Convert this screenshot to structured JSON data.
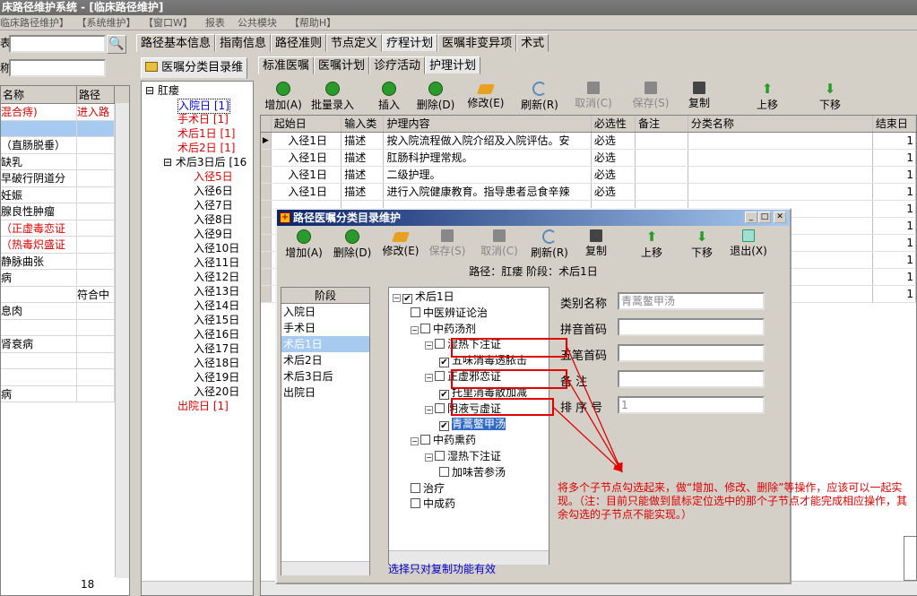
{
  "app": {
    "title": "床路径维护系统 - [临床路径维护]",
    "menu": [
      "临床路径维护】",
      "【系统维护】",
      "【窗口W】",
      "报表",
      "公共模块",
      "【帮助H】"
    ]
  },
  "left": {
    "label_top": "表",
    "label_bottom": "称",
    "headers": [
      "名称",
      "路径"
    ],
    "rows": [
      {
        "name": "混合痔)",
        "path": "进入路",
        "red": true
      },
      {
        "name": "",
        "path": "",
        "selected": true
      },
      {
        "name": "（直肠脱垂）",
        "path": ""
      },
      {
        "name": "缺乳",
        "path": ""
      },
      {
        "name": "早破行阴道分",
        "path": ""
      },
      {
        "name": "妊娠",
        "path": ""
      },
      {
        "name": "腺良性肿瘤",
        "path": ""
      },
      {
        "name": "（正虚毒恋证",
        "path": "",
        "red": true
      },
      {
        "name": "（热毒炽盛证",
        "path": "",
        "red": true
      },
      {
        "name": "静脉曲张",
        "path": ""
      },
      {
        "name": "病",
        "path": ""
      },
      {
        "name": "",
        "path": "符合中"
      },
      {
        "name": "息肉",
        "path": ""
      },
      {
        "name": "",
        "path": ""
      },
      {
        "name": "肾衰病",
        "path": ""
      },
      {
        "name": "",
        "path": ""
      },
      {
        "name": "",
        "path": ""
      },
      {
        "name": "病",
        "path": ""
      }
    ],
    "count": "18"
  },
  "top_tabs": [
    "路径基本信息",
    "指南信息",
    "路径准则",
    "节点定义",
    "疗程计划",
    "医嘱非变异项",
    "术式"
  ],
  "sub_tab": "医嘱分类目录维",
  "inner_tabs": [
    "标准医嘱",
    "医嘱计划",
    "诊疗活动",
    "护理计划"
  ],
  "path_tree": {
    "root": "肛瘘",
    "items": [
      {
        "label": "入院日 [1]",
        "color": "blue",
        "indent": 0
      },
      {
        "label": "手术日 [1]",
        "color": "red",
        "indent": 0
      },
      {
        "label": "术后1日 [1]",
        "color": "red",
        "indent": 0
      },
      {
        "label": "术后2日 [1]",
        "color": "red",
        "indent": 0
      },
      {
        "label": "术后3日后 [16",
        "color": "black",
        "indent": 0
      },
      {
        "label": "入径5日",
        "color": "red",
        "indent": 1
      },
      {
        "label": "入径6日",
        "color": "black",
        "indent": 1
      },
      {
        "label": "入径7日",
        "color": "black",
        "indent": 1
      },
      {
        "label": "入径8日",
        "color": "black",
        "indent": 1
      },
      {
        "label": "入径9日",
        "color": "black",
        "indent": 1
      },
      {
        "label": "入径10日",
        "color": "black",
        "indent": 1
      },
      {
        "label": "入径11日",
        "color": "black",
        "indent": 1
      },
      {
        "label": "入径12日",
        "color": "black",
        "indent": 1
      },
      {
        "label": "入径13日",
        "color": "black",
        "indent": 1
      },
      {
        "label": "入径14日",
        "color": "black",
        "indent": 1
      },
      {
        "label": "入径15日",
        "color": "black",
        "indent": 1
      },
      {
        "label": "入径16日",
        "color": "black",
        "indent": 1
      },
      {
        "label": "入径17日",
        "color": "black",
        "indent": 1
      },
      {
        "label": "入径18日",
        "color": "black",
        "indent": 1
      },
      {
        "label": "入径19日",
        "color": "black",
        "indent": 1
      },
      {
        "label": "入径20日",
        "color": "black",
        "indent": 1
      },
      {
        "label": "出院日 [1]",
        "color": "red",
        "indent": 0
      }
    ]
  },
  "toolbar": [
    {
      "label": "增加(A)",
      "icon": "add-icon",
      "color": "#2a9a2a"
    },
    {
      "label": "批量录入",
      "icon": "batch-add-icon",
      "color": "#2a9a2a"
    },
    {
      "label": "插入",
      "icon": "insert-icon",
      "color": "#2a9a2a"
    },
    {
      "label": "删除(D)",
      "icon": "delete-icon",
      "color": "#2a9a2a"
    },
    {
      "label": "修改(E)",
      "icon": "edit-icon",
      "color": "#e8a020"
    },
    {
      "label": "刷新(R)",
      "icon": "refresh-icon",
      "color": "#5a8ac0"
    },
    {
      "label": "取消(C)",
      "icon": "cancel-icon",
      "color": "#888888"
    },
    {
      "label": "保存(S)",
      "icon": "save-icon",
      "color": "#888888"
    },
    {
      "label": "复制",
      "icon": "copy-icon",
      "color": "#444444"
    },
    {
      "label": "上移",
      "icon": "up-arrow-icon",
      "color": "#2a9a2a"
    },
    {
      "label": "下移",
      "icon": "down-arrow-icon",
      "color": "#2a9a2a"
    }
  ],
  "grid": {
    "headers": [
      "起始日",
      "输入类",
      "护理内容",
      "必选性",
      "备注",
      "分类名称",
      "结束日"
    ],
    "rows": [
      [
        "入径1日",
        "描述",
        "按入院流程做入院介绍及入院评估。安",
        "必选",
        "",
        "",
        "1"
      ],
      [
        "入径1日",
        "描述",
        "肛肠科护理常规。",
        "必选",
        "",
        "",
        "1"
      ],
      [
        "入径1日",
        "描述",
        "二级护理。",
        "必选",
        "",
        "",
        "1"
      ],
      [
        "入径1日",
        "描述",
        "进行入院健康教育。指导患者忌食辛辣",
        "必选",
        "",
        "",
        "1"
      ],
      [
        "",
        "",
        "",
        "",
        "",
        "",
        "1"
      ],
      [
        "",
        "",
        "",
        "",
        "",
        "",
        "1"
      ],
      [
        "",
        "",
        "",
        "",
        "",
        "",
        "1"
      ],
      [
        "",
        "",
        "",
        "",
        "",
        "",
        "1"
      ],
      [
        "",
        "",
        "",
        "",
        "",
        "",
        "1"
      ],
      [
        "",
        "",
        "",
        "",
        "",
        "",
        "1"
      ]
    ]
  },
  "dialog": {
    "title": "路径医嘱分类目录维护",
    "toolbar": [
      {
        "label": "增加(A)",
        "icon": "add-icon",
        "color": "#2a9a2a"
      },
      {
        "label": "删除(D)",
        "icon": "delete-icon",
        "color": "#2a9a2a"
      },
      {
        "label": "修改(E)",
        "icon": "edit-icon",
        "color": "#e8a020"
      },
      {
        "label": "保存(S)",
        "icon": "save-icon",
        "color": "#888888"
      },
      {
        "label": "取消(C)",
        "icon": "cancel-icon",
        "color": "#888888"
      },
      {
        "label": "刷新(R)",
        "icon": "refresh-icon",
        "color": "#5a8ac0"
      },
      {
        "label": "复制",
        "icon": "copy-icon",
        "color": "#444444"
      },
      {
        "label": "上移",
        "icon": "up-arrow-icon",
        "color": "#2a9a2a"
      },
      {
        "label": "下移",
        "icon": "down-arrow-icon",
        "color": "#2a9a2a"
      },
      {
        "label": "退出(X)",
        "icon": "exit-icon",
        "color": "#2a9a6a"
      }
    ],
    "path_info": "路径：肛瘘    阶段：术后1日",
    "stage_header": "阶段",
    "stages": [
      "入院日",
      "手术日",
      "术后1日",
      "术后2日",
      "术后3日后",
      "出院日"
    ],
    "selected_stage": 2,
    "tree": [
      {
        "label": "术后1日",
        "checked": true,
        "indent": 0,
        "expander": "−"
      },
      {
        "label": "中医辨证论治",
        "checked": false,
        "indent": 1,
        "expander": ""
      },
      {
        "label": "中药汤剂",
        "checked": false,
        "indent": 1,
        "expander": "−"
      },
      {
        "label": "湿热下注证",
        "checked": false,
        "indent": 2,
        "expander": "−"
      },
      {
        "label": "五味消毒透脓击",
        "checked": true,
        "indent": 3,
        "expander": ""
      },
      {
        "label": "正虚邪恋证",
        "checked": false,
        "indent": 2,
        "expander": "−"
      },
      {
        "label": "托里消毒散加减",
        "checked": true,
        "indent": 3,
        "expander": ""
      },
      {
        "label": "阴液亏虚证",
        "checked": false,
        "indent": 2,
        "expander": "−"
      },
      {
        "label": "青蒿鳖甲汤",
        "checked": true,
        "indent": 3,
        "expander": "",
        "selected": true
      },
      {
        "label": "中药熏药",
        "checked": false,
        "indent": 1,
        "expander": "−"
      },
      {
        "label": "湿热下注证",
        "checked": false,
        "indent": 2,
        "expander": "−"
      },
      {
        "label": "加味苦参汤",
        "checked": false,
        "indent": 3,
        "expander": ""
      },
      {
        "label": "治疗",
        "checked": false,
        "indent": 1,
        "expander": ""
      },
      {
        "label": "中成药",
        "checked": false,
        "indent": 1,
        "expander": ""
      }
    ],
    "fields": [
      {
        "label": "类别名称",
        "value": "青蒿鳖甲汤"
      },
      {
        "label": "拼音首码",
        "value": ""
      },
      {
        "label": "五笔首码",
        "value": ""
      },
      {
        "label": "备    注",
        "value": ""
      },
      {
        "label": "排 序 号",
        "value": "1"
      }
    ],
    "footer": "选择只对复制功能有效"
  },
  "annotation": "将多个子节点勾选起来，做“增加、修改、删除”等操作，应该可以一起实现。（注：目前只能做到鼠标定位选中的那个子节点才能完成相应操作，其余勾选的子节点不能实现。）",
  "colors": {
    "accent_red": "#e00000",
    "selection_blue": "#316ac5",
    "title_blue": "#0a246a"
  }
}
